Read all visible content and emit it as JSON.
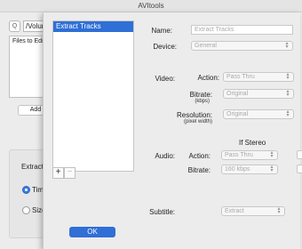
{
  "window": {
    "title": "AVItools"
  },
  "background": {
    "search_glyph": "Q",
    "path_value": "/Volum",
    "files_label": "Files to Edit",
    "add_label": "Add",
    "extract_label": "Extract",
    "radio_time_label": "Time",
    "radio_size_label": "Size"
  },
  "sheet": {
    "tracks": [
      {
        "label": "Extract Tracks"
      }
    ],
    "add_glyph": "+",
    "remove_glyph": "−",
    "name": {
      "label": "Name:",
      "placeholder": "Extract Tracks"
    },
    "device": {
      "label": "Device:",
      "value": "General"
    },
    "video": {
      "label": "Video:",
      "action_label": "Action:",
      "action_value": "Pass Thru",
      "bitrate_label": "Bitrate:",
      "bitrate_unit": "(kbps)",
      "bitrate_value": "Original",
      "resolution_label": "Resolution:",
      "resolution_unit": "(pixel width)",
      "resolution_value": "Original"
    },
    "audio": {
      "if_stereo_label": "If Stereo",
      "label": "Audio:",
      "action_label": "Action:",
      "action_value": "Pass Thru",
      "bitrate_label": "Bitrate:",
      "bitrate_value": "160 kbps"
    },
    "subtitle": {
      "label": "Subtitle:",
      "value": "Extract"
    },
    "ok_label": "OK"
  },
  "colors": {
    "accent": "#2f6fd6",
    "window_bg": "#ececec"
  },
  "icons": {
    "popup_chevron": "chevron-up-down-icon"
  }
}
